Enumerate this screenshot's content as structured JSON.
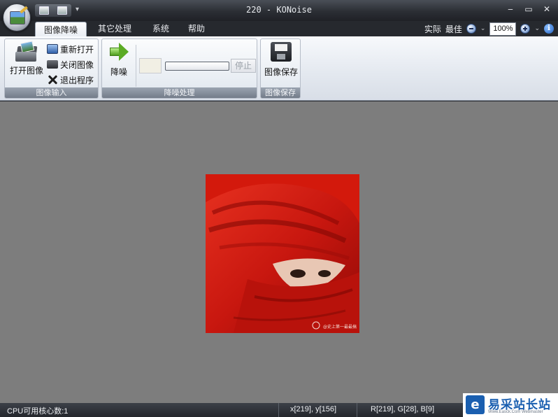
{
  "window": {
    "title": "220 - KONoise",
    "controls": {
      "minimize": "‒",
      "maximize": "▭",
      "close": "✕"
    }
  },
  "tabs": [
    {
      "label": "图像降噪",
      "active": true
    },
    {
      "label": "其它处理",
      "active": false
    },
    {
      "label": "系统",
      "active": false
    },
    {
      "label": "帮助",
      "active": false
    }
  ],
  "view_tools": {
    "actual_label": "实际",
    "best_label": "最佳",
    "zoom_value": "100%"
  },
  "ribbon": {
    "input_group": {
      "label": "图像输入",
      "open_label": "打开图像",
      "reopen_label": "重新打开",
      "close_label": "关闭图像",
      "exit_label": "退出程序"
    },
    "denoise_group": {
      "label": "降噪处理",
      "denoise_label": "降噪",
      "stop_label": "停止",
      "progress": 0
    },
    "save_group": {
      "label": "图像保存",
      "save_label": "图像保存"
    }
  },
  "canvas": {
    "background": "#7d7d7d",
    "image_caption": "@史上第一最最搞"
  },
  "status": {
    "cpu": "CPU可用核心数:1",
    "coords": "x[219], y[156]",
    "rgb": "R[219], G[28], B[9]"
  },
  "watermark": {
    "title": "易采站长站",
    "subtitle": "Www.Easck.Com Webmaster"
  },
  "colors": {
    "accent": "#1a5fb0",
    "photo_red": "#db1c09"
  }
}
